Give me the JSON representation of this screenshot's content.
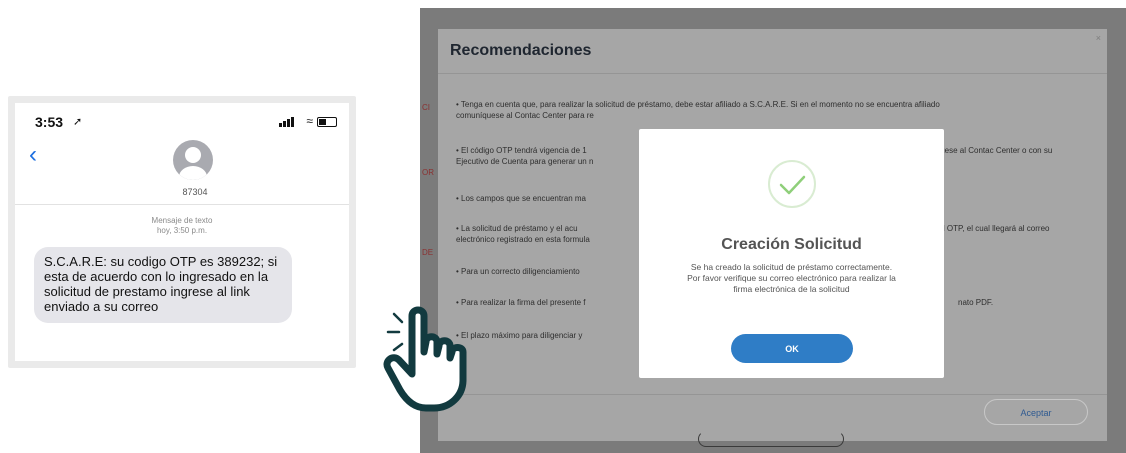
{
  "sms": {
    "time": "3:53",
    "contact": "87304",
    "meta_label": "Mensaje de texto",
    "meta_time": "hoy, 3:50 p.m.",
    "message": "S.C.A.R.E: su codigo OTP es 389232; si esta de acuerdo con lo ingresado en la solicitud de prestamo ingrese al link enviado a su correo"
  },
  "modal": {
    "title": "Recomendaciones",
    "close": "×",
    "items": [
      {
        "line1": "•  Tenga en cuenta que, para realizar la solicitud de préstamo, debe estar afiliado a S.C.A.R.E. Si en el momento no se encuentra afiliado",
        "line2": "comuníquese al Contac Center para re"
      },
      {
        "line1": "•  El código OTP tendrá vigencia de 1",
        "line1b": "muníquese al Contac Center o con su",
        "line2": "Ejecutivo de Cuenta para generar un n"
      },
      {
        "line1": "•  Los campos que se encuentran ma"
      },
      {
        "line1": "•  La solicitud de préstamo y el acu",
        "line1b": "guridad OTP, el cual llegará al correo",
        "line2": "electrónico registrado en esta formula"
      },
      {
        "line1": "•  Para un correcto diligenciamiento"
      },
      {
        "line1": "•  Para realizar la firma del presente f",
        "line1b": "nato PDF."
      },
      {
        "line1": "•  El plazo máximo para diligenciar y"
      }
    ],
    "accept_label": "Aceptar"
  },
  "dialog": {
    "title": "Creación Solicitud",
    "message": "Se ha creado la solicitud de préstamo correctamente. Por favor verifique su correo electrónico para realizar la firma electrónica de la solicitud",
    "ok_label": "OK"
  },
  "colors": {
    "ok_button": "#2f7dc6",
    "success_check": "#8fcf7a",
    "hand_outline": "#123a3f",
    "bubble": "#e5e5ea",
    "back_link": "#1d6fe0"
  },
  "icons": [
    "location-arrow-icon",
    "signal-icon",
    "wifi-icon",
    "battery-icon",
    "back-chevron-icon",
    "contact-avatar-icon",
    "check-circle-icon",
    "pointer-hand-icon"
  ]
}
